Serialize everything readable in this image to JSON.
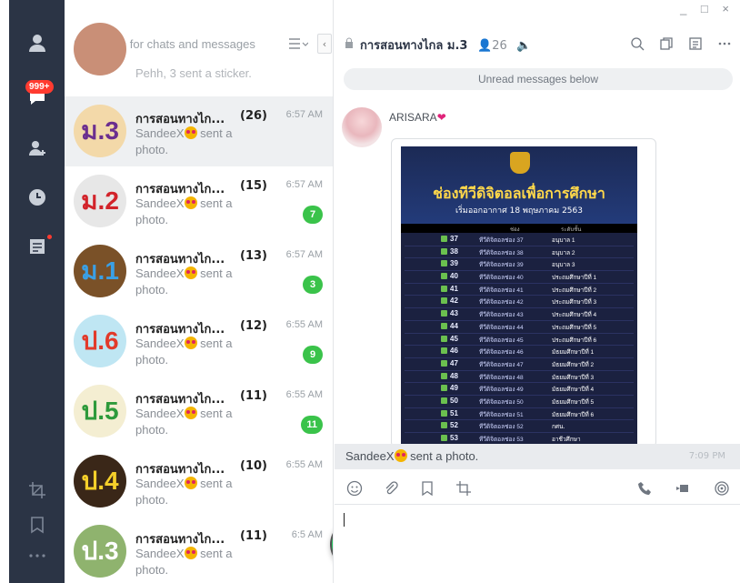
{
  "window": {
    "controls": "_ □ ×"
  },
  "rail": {
    "badge": "999+",
    "colors": {
      "bg": "#2b3445",
      "icon": "#c9cfd8",
      "badge": "#ff3b30"
    },
    "icons": [
      "profile-icon",
      "chats-icon",
      "add-friend-icon",
      "clock-icon",
      "notes-icon",
      "crop-icon",
      "bookmark-icon",
      "more-icon"
    ]
  },
  "search": {
    "placeholder": "Search for chats and messages"
  },
  "chat_partial": {
    "preview": "Pehh, 3 sent a sticker."
  },
  "chats": [
    {
      "avatar_text": "ม.3",
      "name": "การสอนทางไก...",
      "count": "(26)",
      "time": "6:57 AM",
      "preview_sender": "SandeeX",
      "preview_text": "sent a photo.",
      "unread": "",
      "selected": true,
      "avatar_bg": "#f3d9a9",
      "avatar_color": "#6b2e8f"
    },
    {
      "avatar_text": "ม.2",
      "name": "การสอนทางไก...",
      "count": "(15)",
      "time": "6:57 AM",
      "preview_sender": "SandeeX",
      "preview_text": "sent a photo.",
      "unread": "7",
      "avatar_bg": "#e7e7e7",
      "avatar_color": "#d2232a"
    },
    {
      "avatar_text": "ม.1",
      "name": "การสอนทางไก...",
      "count": "(13)",
      "time": "6:57 AM",
      "preview_sender": "SandeeX",
      "preview_text": "sent a photo.",
      "unread": "3",
      "avatar_bg": "#7a5128",
      "avatar_color": "#3aa0e6"
    },
    {
      "avatar_text": "ป.6",
      "name": "การสอนทางไก...",
      "count": "(12)",
      "time": "6:55 AM",
      "preview_sender": "SandeeX",
      "preview_text": "sent a photo.",
      "unread": "9",
      "avatar_bg": "#bfe6f3",
      "avatar_color": "#e23a2a"
    },
    {
      "avatar_text": "ป.5",
      "name": "การสอนทางไก...",
      "count": "(11)",
      "time": "6:55 AM",
      "preview_sender": "SandeeX",
      "preview_text": "sent a photo.",
      "unread": "11",
      "avatar_bg": "#f4eed2",
      "avatar_color": "#2e9a3b"
    },
    {
      "avatar_text": "ป.4",
      "name": "การสอนทางไก...",
      "count": "(10)",
      "time": "6:55 AM",
      "preview_sender": "SandeeX",
      "preview_text": "sent a photo.",
      "unread": "",
      "avatar_bg": "#3a2718",
      "avatar_color": "#f6d02a"
    },
    {
      "avatar_text": "ป.3",
      "name": "การสอนทางไก...",
      "count": "(11)",
      "time": "6:5 AM",
      "preview_sender": "SandeeX",
      "preview_text": "sent a photo.",
      "unread": "",
      "avatar_bg": "#8fb36e",
      "avatar_color": "#ffffff"
    }
  ],
  "fab": {
    "label": "+"
  },
  "room": {
    "title": "การสอนทางไกล ม.3",
    "members": "26",
    "unread_banner": "Unread messages below",
    "header_icons": [
      "search-icon",
      "copy-icon",
      "notes-icon",
      "more-icon"
    ]
  },
  "message": {
    "sender": "ARISARA",
    "poster": {
      "title": "ช่องทีวีดิจิตอลเพื่อการศึกษา",
      "subtitle": "เริ่มออกอากาศ 18 พฤษภาคม 2563",
      "col1": "ช่อง",
      "col2": "ระดับชั้น",
      "rows": [
        {
          "num": "37",
          "channel": "ทีวีดิจิตอลช่อง 37",
          "level": "อนุบาล 1"
        },
        {
          "num": "38",
          "channel": "ทีวีดิจิตอลช่อง 38",
          "level": "อนุบาล 2"
        },
        {
          "num": "39",
          "channel": "ทีวีดิจิตอลช่อง 39",
          "level": "อนุบาล 3"
        },
        {
          "num": "40",
          "channel": "ทีวีดิจิตอลช่อง 40",
          "level": "ประถมศึกษาปีที่ 1"
        },
        {
          "num": "41",
          "channel": "ทีวีดิจิตอลช่อง 41",
          "level": "ประถมศึกษาปีที่ 2"
        },
        {
          "num": "42",
          "channel": "ทีวีดิจิตอลช่อง 42",
          "level": "ประถมศึกษาปีที่ 3"
        },
        {
          "num": "43",
          "channel": "ทีวีดิจิตอลช่อง 43",
          "level": "ประถมศึกษาปีที่ 4"
        },
        {
          "num": "44",
          "channel": "ทีวีดิจิตอลช่อง 44",
          "level": "ประถมศึกษาปีที่ 5"
        },
        {
          "num": "45",
          "channel": "ทีวีดิจิตอลช่อง 45",
          "level": "ประถมศึกษาปีที่ 6"
        },
        {
          "num": "46",
          "channel": "ทีวีดิจิตอลช่อง 46",
          "level": "มัธยมศึกษาปีที่ 1"
        },
        {
          "num": "47",
          "channel": "ทีวีดิจิตอลช่อง 47",
          "level": "มัธยมศึกษาปีที่ 2"
        },
        {
          "num": "48",
          "channel": "ทีวีดิจิตอลช่อง 48",
          "level": "มัธยมศึกษาปีที่ 3"
        },
        {
          "num": "49",
          "channel": "ทีวีดิจิตอลช่อง 49",
          "level": "มัธยมศึกษาปีที่ 4"
        },
        {
          "num": "50",
          "channel": "ทีวีดิจิตอลช่อง 50",
          "level": "มัธยมศึกษาปีที่ 5"
        },
        {
          "num": "51",
          "channel": "ทีวีดิจิตอลช่อง 51",
          "level": "มัธยมศึกษาปีที่ 6"
        },
        {
          "num": "52",
          "channel": "ทีวีดิจิตอลช่อง 52",
          "level": "กศน."
        },
        {
          "num": "53",
          "channel": "ทีวีดิจิตอลช่อง 53",
          "level": "อาชีวศึกษา"
        }
      ]
    }
  },
  "notice": {
    "sender": "SandeeX",
    "text": "sent a photo.",
    "time": "7:09 PM"
  },
  "toolbar": {
    "left_icons": [
      "emoji-icon",
      "attach-icon",
      "bookmark-icon",
      "screenshot-icon"
    ],
    "right_icons": [
      "phone-icon",
      "video-icon",
      "live-icon"
    ]
  },
  "composer": {
    "placeholder": ""
  },
  "colors": {
    "accent": "#1ecc5e",
    "unread_badge": "#3ac34a",
    "selected_row": "#eef0f2"
  }
}
